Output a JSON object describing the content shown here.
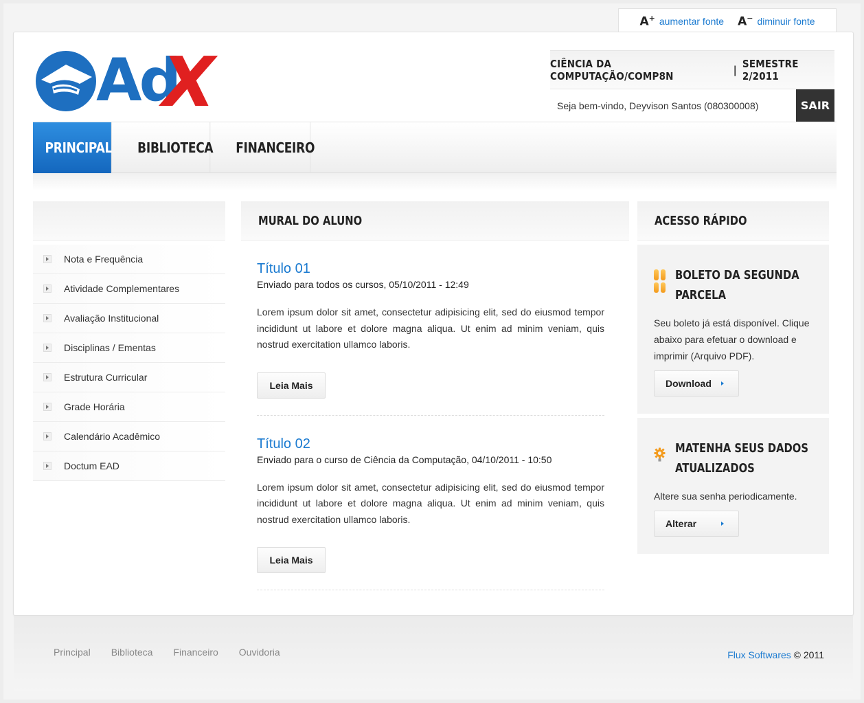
{
  "font_controls": {
    "increase_icon": "A",
    "increase_sign": "+",
    "increase_label": "aumentar fonte",
    "decrease_icon": "A",
    "decrease_sign": "−",
    "decrease_label": "diminuir fonte"
  },
  "logo": {
    "text": "Ad",
    "x": "X"
  },
  "header": {
    "course": "CIÊNCIA DA COMPUTAÇÃO/COMP8N",
    "separator": "|",
    "semester": "SEMESTRE 2/2011",
    "welcome": "Seja bem-vindo, Deyvison Santos (080300008)",
    "logout_label": "SAIR"
  },
  "nav": {
    "items": [
      {
        "label": "PRINCIPAL",
        "active": true
      },
      {
        "label": "BIBLIOTECA",
        "active": false
      },
      {
        "label": "FINANCEIRO",
        "active": false
      }
    ]
  },
  "sidebar": {
    "items": [
      {
        "label": "Nota e Frequência"
      },
      {
        "label": "Atividade Complementares"
      },
      {
        "label": "Avaliação Institucional"
      },
      {
        "label": "Disciplinas / Ementas"
      },
      {
        "label": "Estrutura Curricular"
      },
      {
        "label": "Grade Horária"
      },
      {
        "label": "Calendário Acadêmico"
      },
      {
        "label": "Doctum EAD"
      }
    ]
  },
  "mural": {
    "title": "MURAL DO ALUNO",
    "posts": [
      {
        "title": "Título 01",
        "meta": "Enviado para todos os cursos, 05/10/2011 - 12:49",
        "body": "Lorem ipsum dolor sit amet, consectetur adipisicing elit, sed do eiusmod tempor incididunt ut labore et dolore magna aliqua. Ut enim ad minim veniam, quis nostrud exercitation ullamco laboris.",
        "button": "Leia Mais"
      },
      {
        "title": "Título 02",
        "meta": "Enviado para o curso de Ciência da Computação, 04/10/2011 - 10:50",
        "body": "Lorem ipsum dolor sit amet, consectetur adipisicing elit, sed do eiusmod tempor incididunt ut labore et dolore magna aliqua. Ut enim ad minim veniam, quis nostrud exercitation ullamco laboris.",
        "button": "Leia Mais"
      }
    ]
  },
  "quick_access": {
    "title": "ACESSO RÁPIDO",
    "boxes": [
      {
        "icon": "grid-icon",
        "title_line1": "BOLETO DA SEGUNDA",
        "title_line2": "PARCELA",
        "text": "Seu boleto já está disponível. Clique abaixo para efetuar o download e imprimir (Arquivo PDF).",
        "button": "Download"
      },
      {
        "icon": "gear-icon",
        "title_line1": "MATENHA SEUS DADOS",
        "title_line2": "ATUALIZADOS",
        "text": "Altere sua senha periodicamente.",
        "button": "Alterar"
      }
    ]
  },
  "footer": {
    "links": [
      "Principal",
      "Biblioteca",
      "Financeiro",
      "Ouvidoria"
    ],
    "brand": "Flux Softwares",
    "copyright": " © 2011"
  },
  "colors": {
    "accent": "#1a7ad0",
    "nav_active": "#1e78d0",
    "logo_blue": "#1e6fc0",
    "logo_red": "#e02020",
    "icon_orange": "#f39a1c"
  }
}
